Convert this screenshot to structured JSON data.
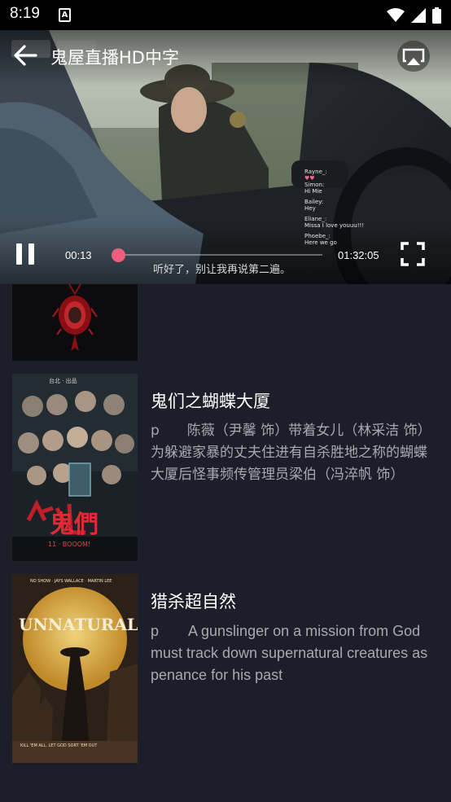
{
  "status_bar": {
    "time": "8:19",
    "notification_icon": "A",
    "icons": [
      "wifi-icon",
      "signal-icon",
      "battery-icon"
    ]
  },
  "player": {
    "title": "鬼屋直播HD中字",
    "current_time": "00:13",
    "duration": "01:32:05",
    "progress": 0.002,
    "subtitle": "听好了，别让我再说第二遍。",
    "chat": [
      {
        "user": "Rayne_:",
        "msg": ""
      },
      {
        "user": "Simon:",
        "msg": "Hi Mie"
      },
      {
        "user": "Bailey:",
        "msg": "Hey"
      },
      {
        "user": "Eliane_:",
        "msg": "Missa I love youuu!!!"
      },
      {
        "user": "Phoebe_:",
        "msg": "Here we go"
      }
    ],
    "accent_color": "#ef5f7d"
  },
  "list": {
    "items": [
      {
        "title": "",
        "description": "",
        "poster": "dark-pendant-poster"
      },
      {
        "title": "鬼们之蝴蝶大厦",
        "description": "p　　陈薇（尹馨 饰）带着女儿（林采洁 饰）为躲避家暴的丈夫住进有自杀胜地之称的蝴蝶大厦后怪事频传管理员梁伯（冯淬帆 饰）",
        "poster": "ghost-building-poster",
        "poster_text": {
          "top": "台北 · 出品",
          "logo": "鬼們",
          "bottom": "11 · BOOOM!"
        }
      },
      {
        "title": "猎杀超自然",
        "description": "p　　A gunslinger on a mission from God must track down supernatural creatures as penance for his past",
        "poster": "unnatural-poster",
        "poster_text": {
          "top": "NO SHOW · JAYS WALLACE · MARTIN LEE",
          "logo": "UNNATURAL",
          "bottom": "KILL 'EM ALL. LET GOD SORT 'EM OUT"
        }
      }
    ]
  }
}
